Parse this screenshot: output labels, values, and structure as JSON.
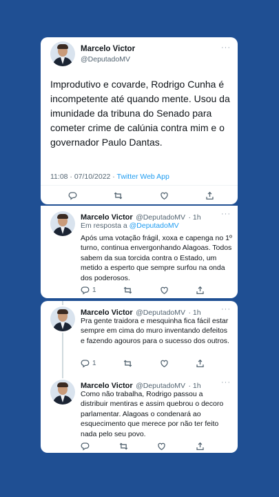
{
  "author": {
    "name": "Marcelo Victor",
    "handle": "@DeputadoMV"
  },
  "main_tweet": {
    "text": "Improdutivo e covarde, Rodrigo Cunha é incompetente até quando mente. Usou da imunidade da tribuna do Senado para cometer crime de calúnia contra mim e o governador Paulo Dantas.",
    "time": "11:08 · 07/10/2022 · ",
    "source": "Twitter Web App",
    "more": "···"
  },
  "replies": [
    {
      "name": "Marcelo Victor",
      "handle": "@DeputadoMV",
      "age": "· 1h",
      "reply_prefix": "Em resposta a ",
      "reply_mention": "@DeputadoMV",
      "text": "Após uma votação frágil, xoxa e capenga no 1º turno, continua envergonhando Alagoas. Todos sabem da sua torcida contra o Estado, um metido a esperto que sempre surfou na onda dos poderosos.",
      "reply_count": "1",
      "more": "···"
    },
    {
      "name": "Marcelo Victor",
      "handle": "@DeputadoMV",
      "age": "· 1h",
      "text": "Pra gente traidora e mesquinha fica fácil estar sempre em cima do muro inventando defeitos e fazendo agouros para o sucesso dos outros.",
      "reply_count": "1",
      "more": "···"
    },
    {
      "name": "Marcelo Victor",
      "handle": "@DeputadoMV",
      "age": "· 1h",
      "text": "Como não trabalha, Rodrigo passou a distribuir mentiras e assim quebrou o decoro parlamentar. Alagoas o condenará ao esquecimento que merece por não ter feito nada pelo seu povo.",
      "reply_count": "",
      "more": "···"
    }
  ],
  "icons": {
    "reply": "reply-icon",
    "retweet": "retweet-icon",
    "like": "heart-icon",
    "share": "share-icon"
  },
  "colors": {
    "background": "#1f4f93",
    "link": "#1d9bf0",
    "secondary": "#536471"
  }
}
